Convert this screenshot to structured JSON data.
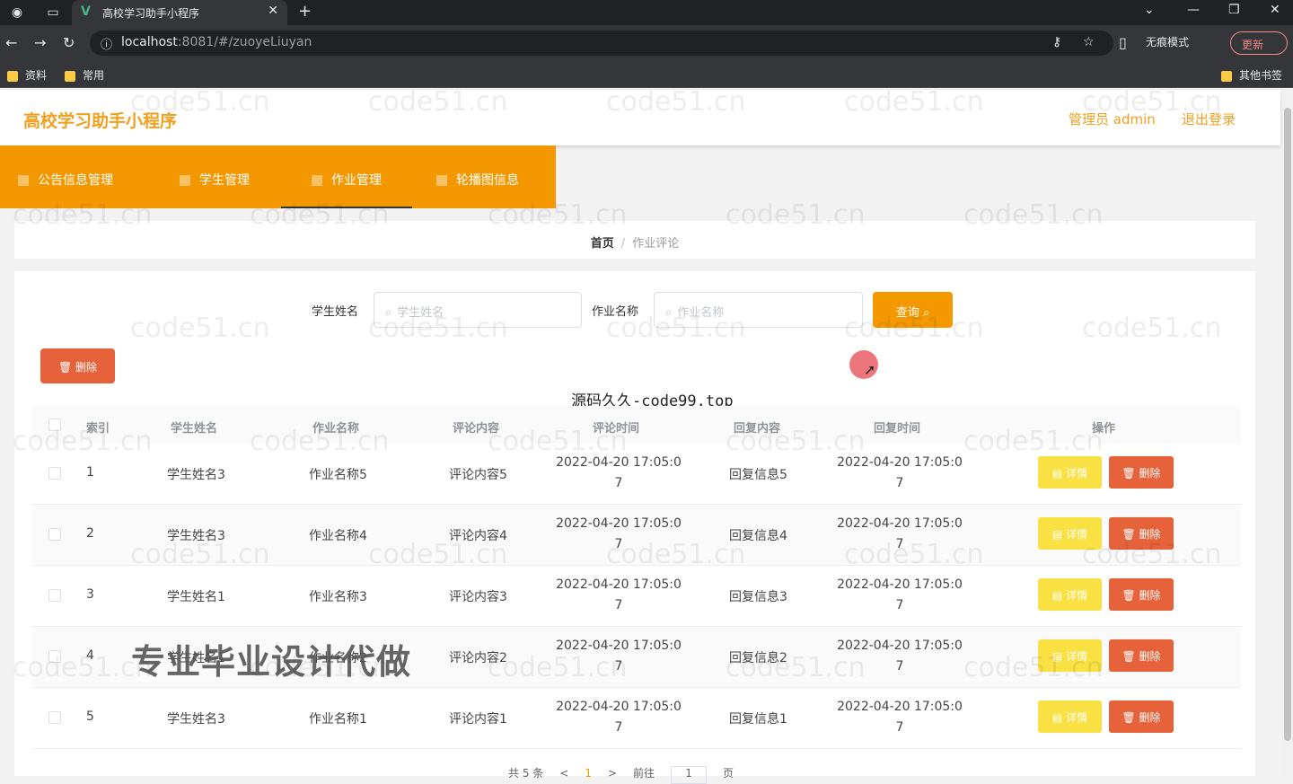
{
  "browser": {
    "tab_title": "高校学习助手小程序",
    "url_host": "localhost",
    "url_path": ":8081/#/zuoyeLiuyan",
    "incognito_label": "无痕模式",
    "update_label": "更新",
    "bookmarks": [
      "资料",
      "常用"
    ],
    "other_bookmarks": "其他书签"
  },
  "header": {
    "app_title": "高校学习助手小程序",
    "admin_label": "管理员 admin",
    "logout_label": "退出登录"
  },
  "menu": [
    {
      "label": "公告信息管理"
    },
    {
      "label": "学生管理"
    },
    {
      "label": "作业管理"
    },
    {
      "label": "轮播图信息"
    }
  ],
  "breadcrumb": {
    "home": "首页",
    "separator": "/",
    "current": "作业评论"
  },
  "search": {
    "student_label": "学生姓名",
    "student_placeholder": "学生姓名",
    "homework_label": "作业名称",
    "homework_placeholder": "作业名称",
    "query_label": "查询"
  },
  "toolbar": {
    "delete_label": "删除"
  },
  "overlay": {
    "site_text": "源码久久-code99.top",
    "banner_text": "专业毕业设计代做",
    "watermark": "code51.cn"
  },
  "table": {
    "headers": [
      "索引",
      "学生姓名",
      "作业名称",
      "评论内容",
      "评论时间",
      "回复内容",
      "回复时间",
      "操作"
    ],
    "detail_label": "详情",
    "delete_label": "删除",
    "rows": [
      {
        "index": "1",
        "student": "学生姓名3",
        "homework": "作业名称5",
        "comment": "评论内容5",
        "comment_time_a": "2022-04-20 17:05:0",
        "comment_time_b": "7",
        "reply": "回复信息5",
        "reply_time_a": "2022-04-20 17:05:0",
        "reply_time_b": "7"
      },
      {
        "index": "2",
        "student": "学生姓名3",
        "homework": "作业名称4",
        "comment": "评论内容4",
        "comment_time_a": "2022-04-20 17:05:0",
        "comment_time_b": "7",
        "reply": "回复信息4",
        "reply_time_a": "2022-04-20 17:05:0",
        "reply_time_b": "7"
      },
      {
        "index": "3",
        "student": "学生姓名1",
        "homework": "作业名称3",
        "comment": "评论内容3",
        "comment_time_a": "2022-04-20 17:05:0",
        "comment_time_b": "7",
        "reply": "回复信息3",
        "reply_time_a": "2022-04-20 17:05:0",
        "reply_time_b": "7"
      },
      {
        "index": "4",
        "student": "学生姓名1",
        "homework": "作业名称2",
        "comment": "评论内容2",
        "comment_time_a": "2022-04-20 17:05:0",
        "comment_time_b": "7",
        "reply": "回复信息2",
        "reply_time_a": "2022-04-20 17:05:0",
        "reply_time_b": "7"
      },
      {
        "index": "5",
        "student": "学生姓名3",
        "homework": "作业名称1",
        "comment": "评论内容1",
        "comment_time_a": "2022-04-20 17:05:0",
        "comment_time_b": "7",
        "reply": "回复信息1",
        "reply_time_a": "2022-04-20 17:05:0",
        "reply_time_b": "7"
      }
    ]
  },
  "pagination": {
    "total": "共 5 条",
    "prev": "<",
    "current": "1",
    "next": ">",
    "goto": "前往",
    "page_value": "1",
    "page_unit": "页"
  }
}
